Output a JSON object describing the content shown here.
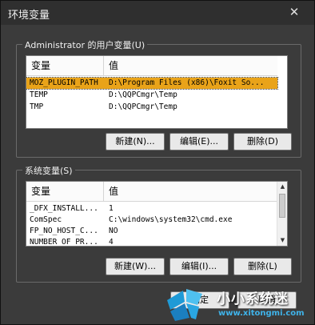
{
  "window": {
    "title": "环境变量",
    "close_glyph": "✕"
  },
  "user_vars": {
    "legend": "Administrator 的用户变量(U)",
    "columns": [
      "变量",
      "值"
    ],
    "rows": [
      {
        "name": "MOZ_PLUGIN_PATH",
        "value": "D:\\Program Files (x86)\\Foxit So...",
        "selected": true
      },
      {
        "name": "TEMP",
        "value": "D:\\QQPCmgr\\Temp",
        "selected": false
      },
      {
        "name": "TMP",
        "value": "D:\\QQPCmgr\\Temp",
        "selected": false
      }
    ],
    "buttons": {
      "new": "新建(N)...",
      "edit": "编辑(E)...",
      "delete": "删除(D)"
    }
  },
  "system_vars": {
    "legend": "系统变量(S)",
    "columns": [
      "变量",
      "值"
    ],
    "rows": [
      {
        "name": "_DFX_INSTALL...",
        "value": "1"
      },
      {
        "name": "ComSpec",
        "value": "C:\\windows\\system32\\cmd.exe"
      },
      {
        "name": "FP_NO_HOST_C...",
        "value": "NO"
      },
      {
        "name": "NUMBER_OF_PR...",
        "value": "4"
      }
    ],
    "buttons": {
      "new": "新建(W)...",
      "edit": "编辑(I)...",
      "delete": "删除(L)"
    }
  },
  "footer": {
    "ok": "确定",
    "cancel": "取消"
  },
  "watermark": {
    "name": "小小系统迷",
    "url": "www.xitongmi.com"
  },
  "colors": {
    "selection": "#e9a319",
    "window_bg": "#3b3b3b",
    "watermark_blue": "#1f9ad6"
  }
}
